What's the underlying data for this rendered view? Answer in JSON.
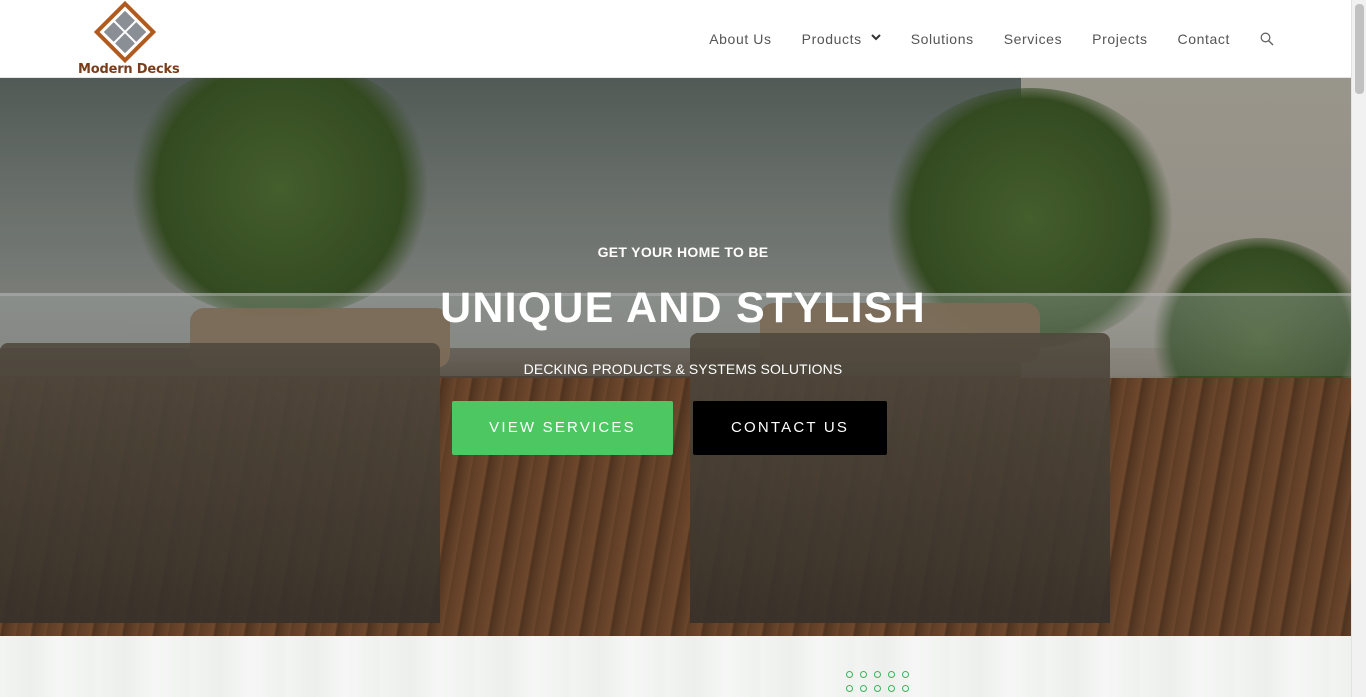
{
  "brand": {
    "name": "Modern Decks",
    "colors": {
      "logo_brown": "#b05a1e",
      "logo_gray": "#8a8f96",
      "accent_green": "#4cc762"
    }
  },
  "nav": {
    "items": [
      {
        "label": "About Us"
      },
      {
        "label": "Products",
        "has_dropdown": true
      },
      {
        "label": "Solutions"
      },
      {
        "label": "Services"
      },
      {
        "label": "Projects"
      },
      {
        "label": "Contact"
      }
    ],
    "search_icon": "search-icon"
  },
  "hero": {
    "kicker": "GET YOUR HOME TO BE",
    "headline": "UNIQUE AND STYLISH",
    "subheadline": "DECKING PRODUCTS & SYSTEMS SOLUTIONS",
    "primary_button": "VIEW SERVICES",
    "secondary_button": "CONTACT US"
  }
}
